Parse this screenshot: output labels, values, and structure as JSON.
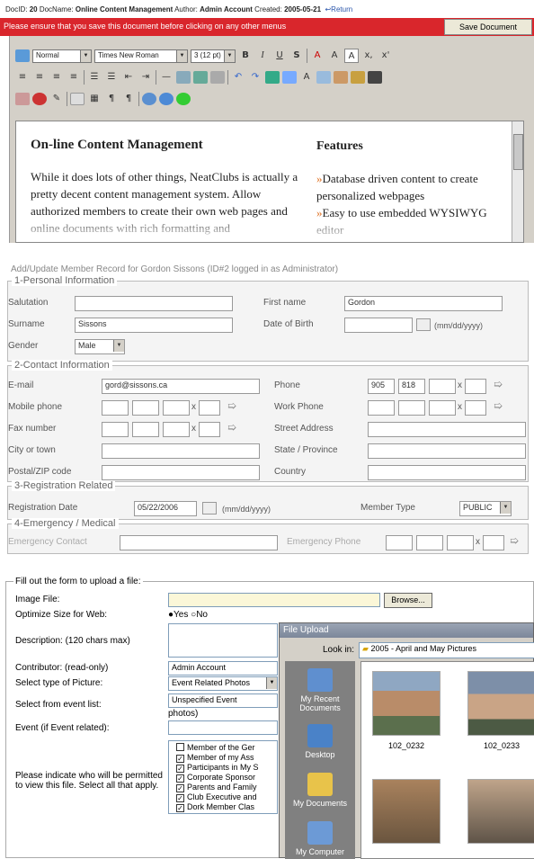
{
  "editor": {
    "header": {
      "docid_label": "DocID:",
      "docid": "20",
      "docname_label": "DocName:",
      "docname": "Online Content Management",
      "author_label": "Author:",
      "author": "Admin Account",
      "created_label": "Created:",
      "created": "2005-05-21",
      "return_label": "Return"
    },
    "warning": "Please ensure that you save this document before clicking on any other menus",
    "save_button": "Save Document",
    "toolbar": {
      "style": "Normal",
      "font": "Times New Roman",
      "size": "3 (12 pt)"
    },
    "content": {
      "heading": "On-line Content Management",
      "body": "While it does lots of other things, NeatClubs is actually a pretty decent content management system. Allow authorized members to create their own web pages and online documents with rich formatting and",
      "features_heading": "Features",
      "features": [
        "Database driven content to create personalized webpages",
        "Easy to use embedded WYSIWYG editor"
      ]
    }
  },
  "member_form": {
    "title": "Add/Update Member Record for Gordon Sissons (ID#2 logged in as Administrator)",
    "sections": {
      "personal": "1-Personal Information",
      "contact": "2-Contact Information",
      "registration": "3-Registration Related",
      "emergency": "4-Emergency / Medical"
    },
    "labels": {
      "salutation": "Salutation",
      "first_name": "First name",
      "surname": "Surname",
      "dob": "Date of Birth",
      "dob_hint": "(mm/dd/yyyy)",
      "gender": "Gender",
      "email": "E-mail",
      "phone": "Phone",
      "mobile": "Mobile phone",
      "work_phone": "Work Phone",
      "fax": "Fax number",
      "street": "Street Address",
      "city": "City or town",
      "state": "State / Province",
      "postal": "Postal/ZIP code",
      "country": "Country",
      "reg_date": "Registration Date",
      "reg_hint": "(mm/dd/yyyy)",
      "member_type": "Member Type",
      "emergency_contact": "Emergency Contact",
      "emergency_phone": "Emergency Phone",
      "ext": "x"
    },
    "values": {
      "salutation": "",
      "first_name": "Gordon",
      "surname": "Sissons",
      "dob": "",
      "gender": "Male",
      "email": "gord@sissons.ca",
      "phone_area": "905",
      "phone_prefix": "818",
      "reg_date": "05/22/2006",
      "member_type": "PUBLIC"
    }
  },
  "upload_form": {
    "legend": "Fill out the form to upload a file:",
    "labels": {
      "image_file": "Image File:",
      "optimize": "Optimize Size for Web:",
      "description": "Description: (120 chars max)",
      "contributor": "Contributor: (read-only)",
      "picture_type": "Select type of Picture:",
      "event_list": "Select from event list:",
      "event": "Event (if Event related):",
      "permissions": "Please indicate who will be permitted to view this file. Select all that apply."
    },
    "browse_label": "Browse...",
    "optimize_yes": "Yes",
    "optimize_no": "No",
    "contributor": "Admin Account",
    "picture_type": "Event Related Photos",
    "event_option": "Unspecified Event",
    "event_option_suffix": "photos)",
    "permissions": [
      {
        "label": "Member of the Ger",
        "checked": false
      },
      {
        "label": "Member of my Ass",
        "checked": true
      },
      {
        "label": "Participants in My S",
        "checked": true
      },
      {
        "label": "Corporate Sponsor",
        "checked": true
      },
      {
        "label": "Parents and Family",
        "checked": true
      },
      {
        "label": "Club Executive and",
        "checked": true
      },
      {
        "label": "Dork Member Clas",
        "checked": true
      }
    ]
  },
  "file_dialog": {
    "title": "File Upload",
    "look_in_label": "Look in:",
    "look_in": "2005 - April and May Pictures",
    "places": [
      "My Recent Documents",
      "Desktop",
      "My Documents",
      "My Computer"
    ],
    "files": [
      "102_0232",
      "102_0233"
    ]
  }
}
